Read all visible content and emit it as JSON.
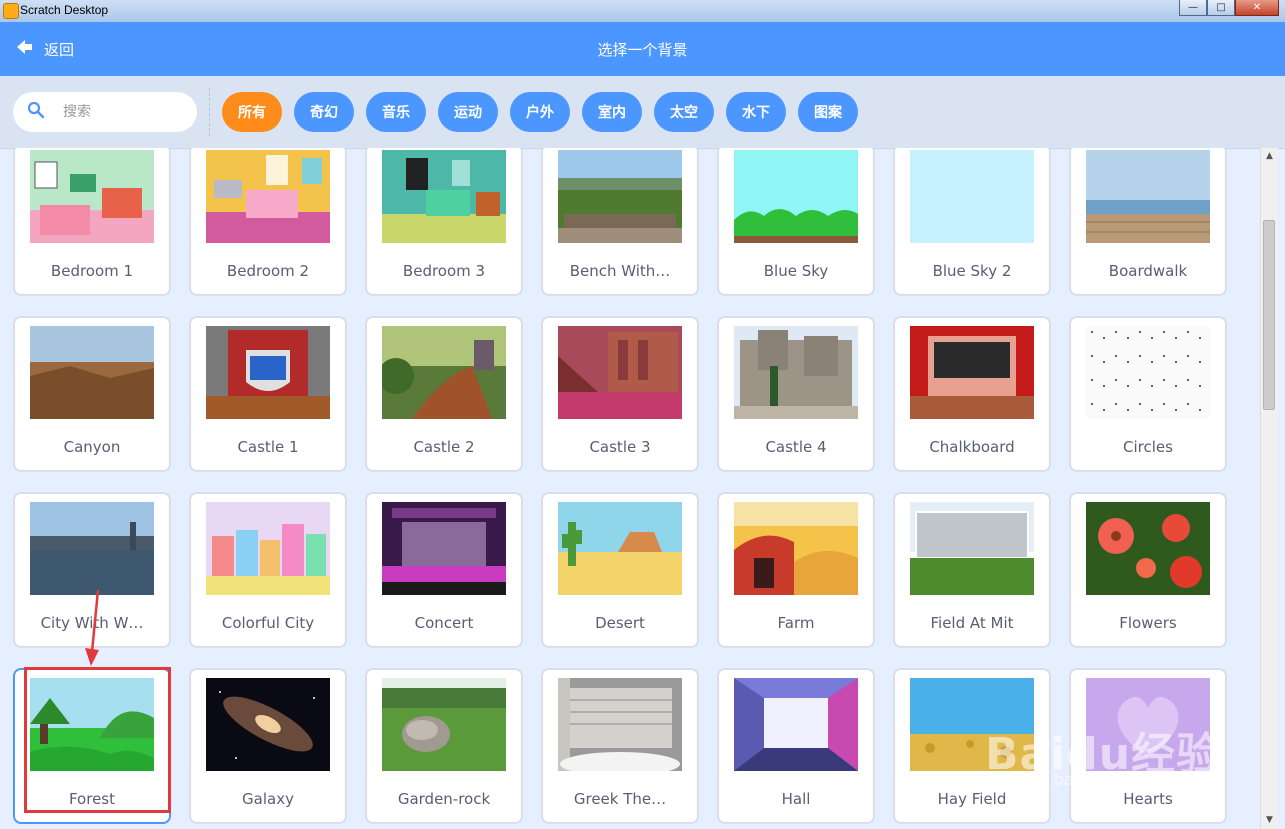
{
  "window": {
    "title": "Scratch Desktop",
    "controls": [
      "—",
      "□",
      "✕"
    ]
  },
  "header": {
    "back_label": "返回",
    "title": "选择一个背景"
  },
  "search": {
    "placeholder": "搜索",
    "value": ""
  },
  "tags": [
    {
      "label": "所有",
      "active": true
    },
    {
      "label": "奇幻",
      "active": false
    },
    {
      "label": "音乐",
      "active": false
    },
    {
      "label": "运动",
      "active": false
    },
    {
      "label": "户外",
      "active": false
    },
    {
      "label": "室内",
      "active": false
    },
    {
      "label": "太空",
      "active": false
    },
    {
      "label": "水下",
      "active": false
    },
    {
      "label": "图案",
      "active": false
    }
  ],
  "backdrops": [
    {
      "name": "Bedroom 1",
      "art": "bedroom1"
    },
    {
      "name": "Bedroom 2",
      "art": "bedroom2"
    },
    {
      "name": "Bedroom 3",
      "art": "bedroom3"
    },
    {
      "name": "Bench With…",
      "art": "bench"
    },
    {
      "name": "Blue Sky",
      "art": "bluesky"
    },
    {
      "name": "Blue Sky 2",
      "art": "bluesky2"
    },
    {
      "name": "Boardwalk",
      "art": "boardwalk"
    },
    {
      "name": "Canyon",
      "art": "canyon"
    },
    {
      "name": "Castle 1",
      "art": "castle1"
    },
    {
      "name": "Castle 2",
      "art": "castle2"
    },
    {
      "name": "Castle 3",
      "art": "castle3"
    },
    {
      "name": "Castle 4",
      "art": "castle4"
    },
    {
      "name": "Chalkboard",
      "art": "chalkboard"
    },
    {
      "name": "Circles",
      "art": "circles"
    },
    {
      "name": "City With W…",
      "art": "city"
    },
    {
      "name": "Colorful City",
      "art": "colorfulcity"
    },
    {
      "name": "Concert",
      "art": "concert"
    },
    {
      "name": "Desert",
      "art": "desert"
    },
    {
      "name": "Farm",
      "art": "farm"
    },
    {
      "name": "Field At Mit",
      "art": "field"
    },
    {
      "name": "Flowers",
      "art": "flowers"
    },
    {
      "name": "Forest",
      "art": "forest",
      "selected": true
    },
    {
      "name": "Galaxy",
      "art": "galaxy"
    },
    {
      "name": "Garden-rock",
      "art": "garden"
    },
    {
      "name": "Greek The…",
      "art": "greek"
    },
    {
      "name": "Hall",
      "art": "hall"
    },
    {
      "name": "Hay Field",
      "art": "hayfield"
    },
    {
      "name": "Hearts",
      "art": "hearts"
    }
  ],
  "watermark": {
    "text": "Baidu经验",
    "sub": "jingyan.baidu.com"
  }
}
